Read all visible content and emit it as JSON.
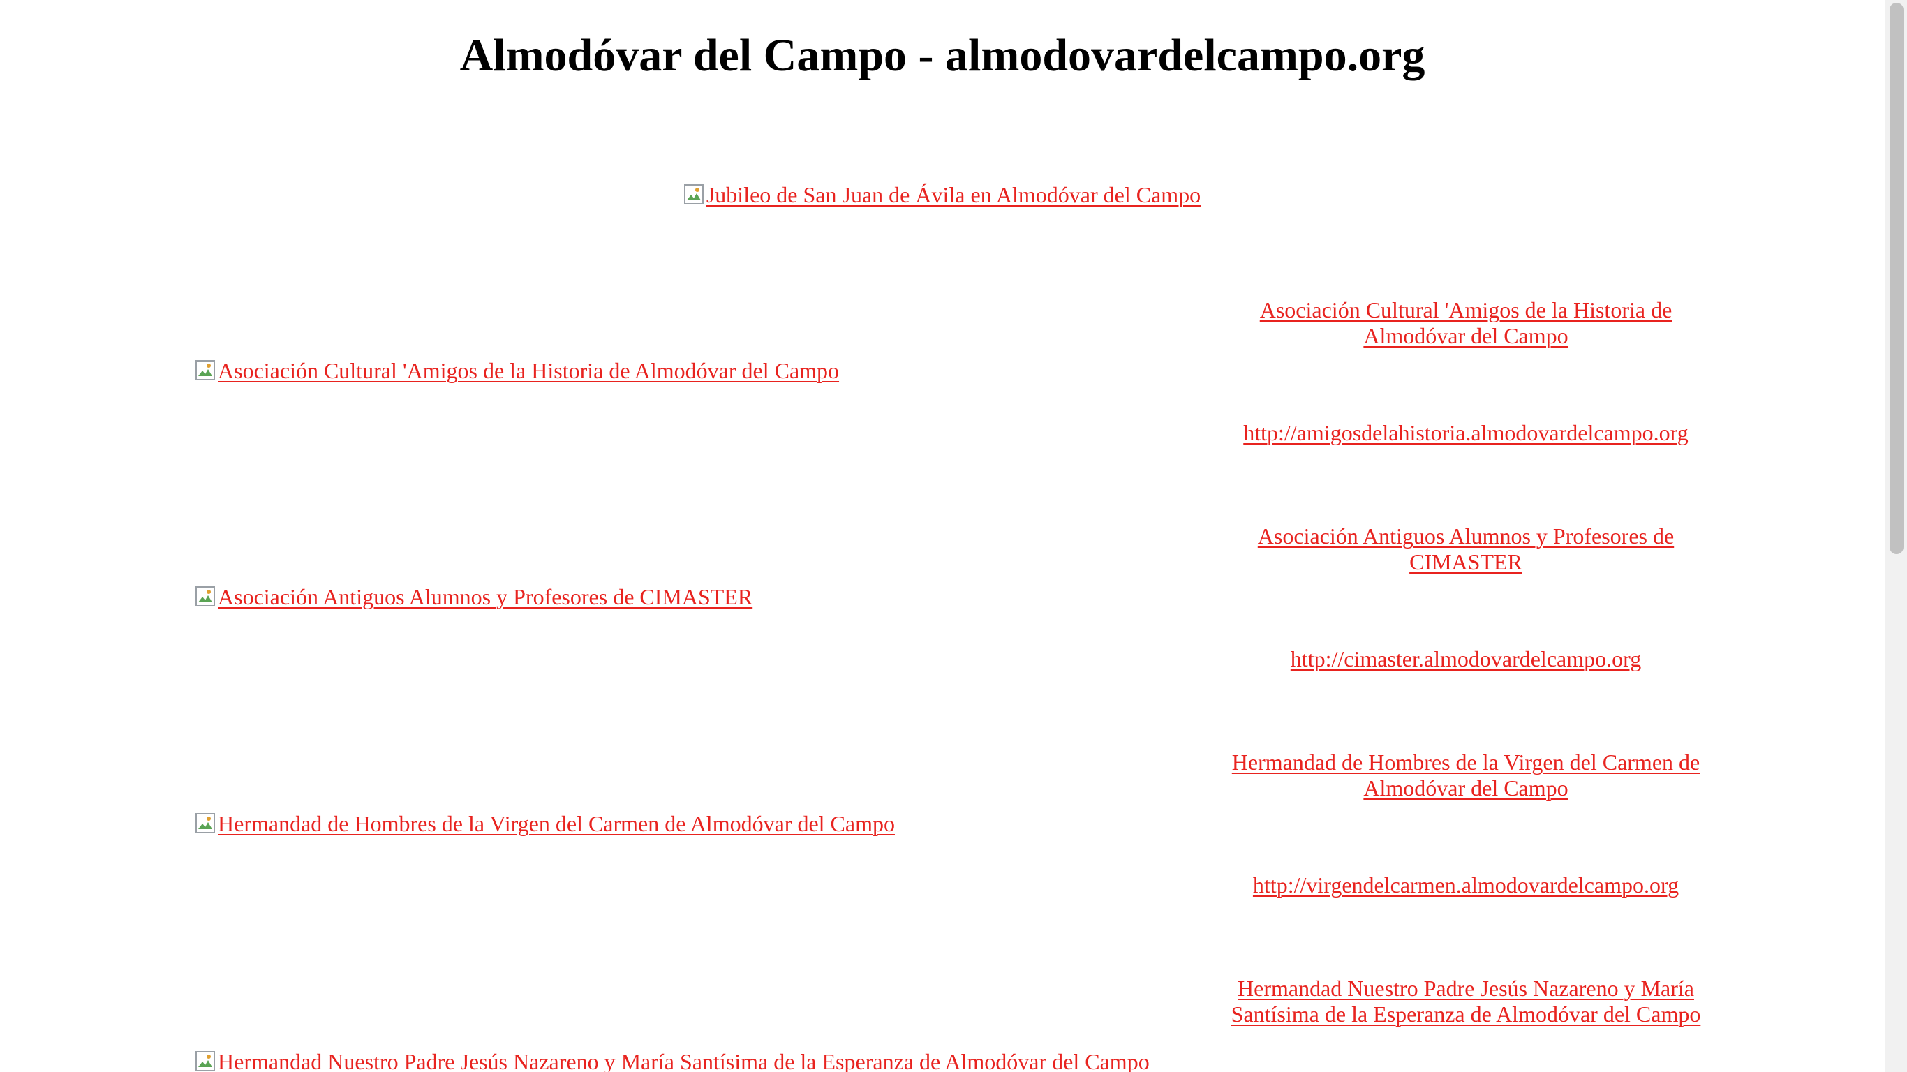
{
  "page": {
    "title": "Almodóvar del Campo - almodovardelcampo.org"
  },
  "banner": {
    "alt": "Jubileo de San Juan de Ávila en Almodóvar del Campo"
  },
  "entries": [
    {
      "image_alt": "Asociación Cultural 'Amigos de la Historia de Almodóvar del Campo",
      "title": "Asociación Cultural 'Amigos de la Historia de Almodóvar del Campo",
      "url": "http://amigosdelahistoria.almodovardelcampo.org"
    },
    {
      "image_alt": "Asociación Antiguos Alumnos y Profesores de CIMASTER",
      "title": "Asociación Antiguos Alumnos y Profesores de CIMASTER",
      "url": "http://cimaster.almodovardelcampo.org"
    },
    {
      "image_alt": "Hermandad de Hombres de la Virgen del Carmen de Almodóvar del Campo",
      "title": "Hermandad de Hombres de la Virgen del Carmen de Almodóvar del Campo",
      "url": "http://virgendelcarmen.almodovardelcampo.org"
    },
    {
      "image_alt": "Hermandad Nuestro Padre Jesús Nazareno y María Santísima de la Esperanza de Almodóvar del Campo",
      "title": "Hermandad Nuestro Padre Jesús Nazareno y María Santísima de la Esperanza de Almodóvar del Campo"
    }
  ],
  "colors": {
    "link": "#e8231f",
    "text": "#000000",
    "background": "#ffffff"
  },
  "icons": {
    "broken_image": "broken-image-icon"
  }
}
